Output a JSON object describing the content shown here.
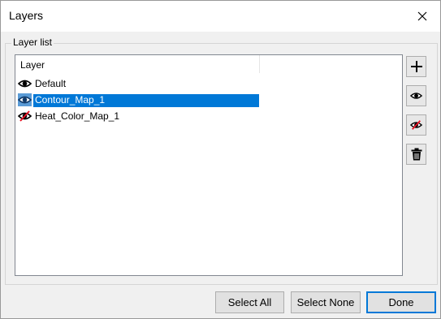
{
  "window": {
    "title": "Layers",
    "close_icon": "close-icon"
  },
  "group": {
    "label": "Layer list"
  },
  "list": {
    "column_header": "Layer",
    "rows": [
      {
        "label": "Default",
        "icon": "eye-icon",
        "selected": false
      },
      {
        "label": "Contour_Map_1",
        "icon": "eye-icon",
        "selected": true
      },
      {
        "label": "Heat_Color_Map_1",
        "icon": "eye-hidden-icon",
        "selected": false
      }
    ]
  },
  "tools": [
    {
      "name": "add-layer-button",
      "icon": "plus-icon"
    },
    {
      "name": "show-layer-button",
      "icon": "eye-icon"
    },
    {
      "name": "hide-layer-button",
      "icon": "eye-hidden-icon"
    },
    {
      "name": "delete-layer-button",
      "icon": "trash-icon"
    }
  ],
  "buttons": {
    "select_all": "Select All",
    "select_none": "Select None",
    "done": "Done"
  },
  "colors": {
    "selection": "#0078d7",
    "hidden_slash": "#e81123"
  }
}
